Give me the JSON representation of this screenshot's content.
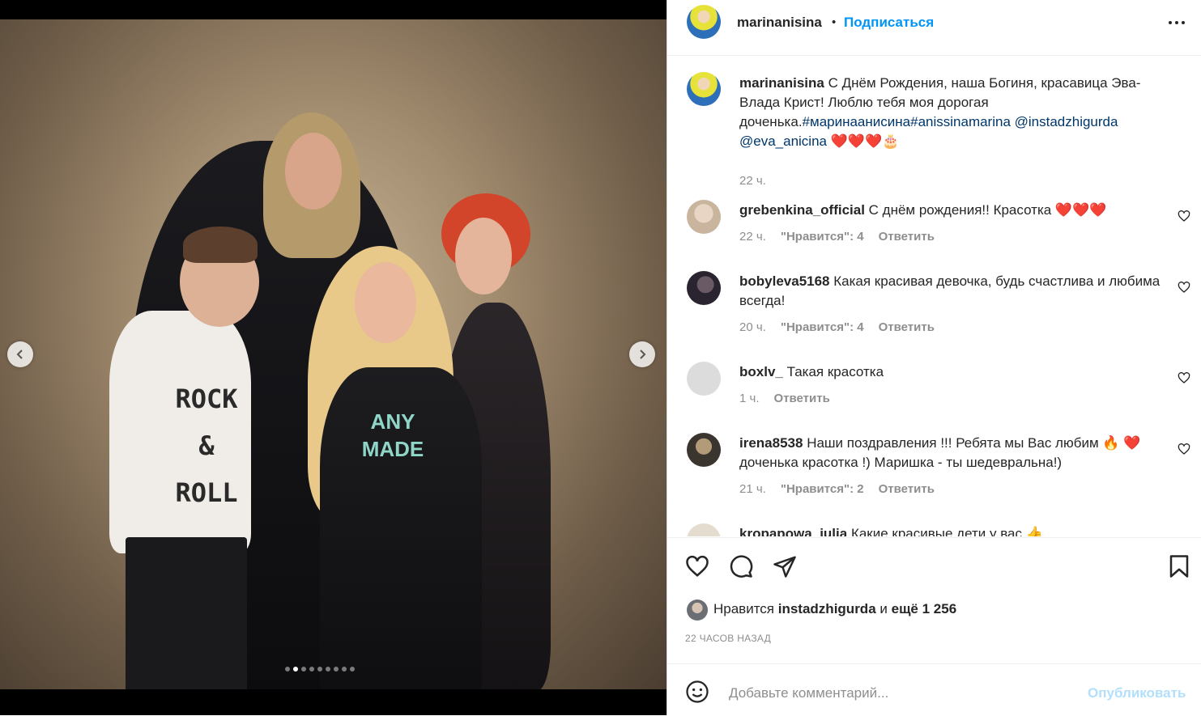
{
  "post": {
    "username": "marinanisina",
    "separator": "•",
    "follow_label": "Подписаться",
    "more_icon": "more-horizontal-icon",
    "caption_text": "С Днём Рождения, наша Богиня, красавица Эва-Влада Крист! Люблю тебя моя дорогая доченька.",
    "caption_tags": "#маринаанисина#anissinamarina @instadzhigurda @eva_anicina",
    "caption_emoji": "❤️❤️❤️🎂",
    "caption_time": "22 ч."
  },
  "media": {
    "slides_total": 9,
    "active_slide": 1,
    "prev_icon": "chevron-left-icon",
    "next_icon": "chevron-right-icon",
    "shirt_text": "ROCK & ROLL",
    "dress_text": "ANY MADE"
  },
  "comments": [
    {
      "user": "grebenkina_official",
      "text": "С днём рождения!! Красотка ❤️❤️❤️",
      "time": "22 ч.",
      "likes": "\"Нравится\": 4",
      "reply": "Ответить"
    },
    {
      "user": "bobyleva5168",
      "text": "Какая красивая девочка, будь счастлива и любима всегда!",
      "time": "20 ч.",
      "likes": "\"Нравится\": 4",
      "reply": "Ответить"
    },
    {
      "user": "boxlv_",
      "text": "Такая красотка",
      "time": "1 ч.",
      "likes": "",
      "reply": "Ответить"
    },
    {
      "user": "irena8538",
      "text": "Наши поздравления !!! Ребята мы Вас любим 🔥 ❤️ доченька красотка !) Маришка - ты шедевральна!)",
      "time": "21 ч.",
      "likes": "\"Нравится\": 2",
      "reply": "Ответить"
    },
    {
      "user": "kropapowa_julia",
      "text": "Какие красивые дети у вас 👍"
    }
  ],
  "actions": {
    "like_icon": "heart-icon",
    "comment_icon": "comment-icon",
    "share_icon": "paper-plane-icon",
    "save_icon": "bookmark-icon",
    "likes_prefix": "Нравится",
    "likes_user": "instadzhigurda",
    "likes_mid": "и",
    "likes_count": "ещё 1 256",
    "timestamp": "22 ЧАСОВ НАЗАД"
  },
  "add_comment": {
    "emoji_icon": "smiley-icon",
    "placeholder": "Добавьте комментарий...",
    "post_label": "Опубликовать"
  },
  "colors": {
    "accent": "#0095f6",
    "link": "#00376b",
    "muted": "#8e8e8e",
    "like_red": "#ed4956",
    "post_disabled": "#b2dffc"
  }
}
